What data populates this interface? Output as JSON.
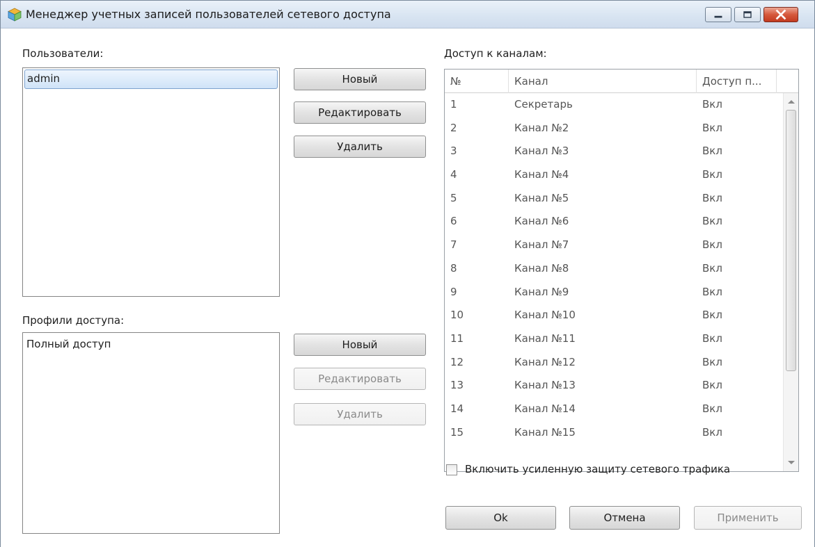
{
  "window": {
    "title": "Менеджер учетных записей пользователей сетевого доступа",
    "icon": "cube-app-icon"
  },
  "users": {
    "label": "Пользователи:",
    "items": [
      "admin"
    ],
    "selected": "admin",
    "buttons": {
      "new": "Новый",
      "edit": "Редактировать",
      "delete": "Удалить"
    }
  },
  "profiles": {
    "label": "Профили доступа:",
    "items": [
      "Полный доступ"
    ],
    "buttons": {
      "new": "Новый",
      "edit": "Редактировать",
      "delete": "Удалить"
    }
  },
  "channels": {
    "label": "Доступ к каналам:",
    "columns": [
      "№",
      "Канал",
      "Доступ п..."
    ],
    "rows": [
      [
        "1",
        "Секретарь",
        "Вкл"
      ],
      [
        "2",
        "Канал №2",
        "Вкл"
      ],
      [
        "3",
        "Канал №3",
        "Вкл"
      ],
      [
        "4",
        "Канал №4",
        "Вкл"
      ],
      [
        "5",
        "Канал №5",
        "Вкл"
      ],
      [
        "6",
        "Канал №6",
        "Вкл"
      ],
      [
        "7",
        "Канал №7",
        "Вкл"
      ],
      [
        "8",
        "Канал №8",
        "Вкл"
      ],
      [
        "9",
        "Канал №9",
        "Вкл"
      ],
      [
        "10",
        "Канал №10",
        "Вкл"
      ],
      [
        "11",
        "Канал №11",
        "Вкл"
      ],
      [
        "12",
        "Канал №12",
        "Вкл"
      ],
      [
        "13",
        "Канал №13",
        "Вкл"
      ],
      [
        "14",
        "Канал №14",
        "Вкл"
      ],
      [
        "15",
        "Канал №15",
        "Вкл"
      ]
    ]
  },
  "protection_checkbox": {
    "label": "Включить усиленную защиту сетевого трафика",
    "checked": false
  },
  "footer": {
    "ok": "Ok",
    "cancel": "Отмена",
    "apply": "Применить"
  }
}
